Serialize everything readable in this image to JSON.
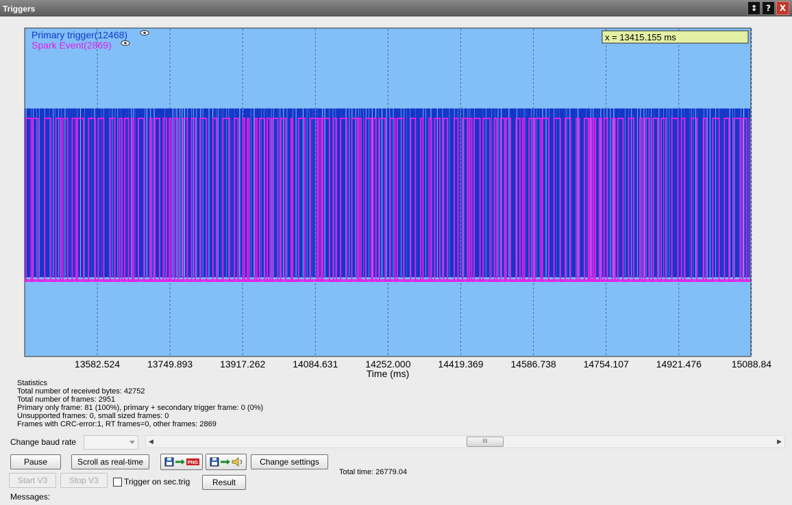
{
  "window": {
    "title": "Triggers",
    "buttons": [
      "↕",
      "?",
      "X"
    ]
  },
  "chart_data": {
    "type": "line",
    "series": [
      {
        "name": "Primary trigger(12468)",
        "color": "#1437c8"
      },
      {
        "name": "Spark Event(2869)",
        "color": "#e020e6"
      }
    ],
    "cursor_readout": "x = 13415.155 ms",
    "xlabel": "Time (ms)",
    "x_ticks": [
      "13582.524",
      "13749.893",
      "13917.262",
      "14084.631",
      "14252.000",
      "14419.369",
      "14586.738",
      "14754.107",
      "14921.476",
      "15088.84"
    ],
    "xlim": [
      13415.155,
      15088.845
    ],
    "grid": "vertical dashed",
    "legend": "top-left",
    "background": "#82bff8"
  },
  "statistics": {
    "heading": "Statistics",
    "lines": [
      "Total number of received bytes: 42752",
      "Total number of frames: 2951",
      "Primary only frame: 81 (100%), primary + secondary trigger frame: 0 (0%)",
      "Unsupported frames: 0, small sized frames: 0",
      "Frames with CRC-error:1, RT frames=0, other frames: 2869"
    ]
  },
  "controls": {
    "baud_label": "Change baud rate",
    "baud_value": "",
    "scroll_thumb": "III",
    "pause": "Pause",
    "scroll_realtime": "Scroll as real-time",
    "png_badge": "PNG",
    "change_settings": "Change settings",
    "total_time": "Total time: 26779.04",
    "start_v3": "Start V3",
    "stop_v3": "Stop V3",
    "trigger_on_sec": "Trigger on sec.trig",
    "result": "Result",
    "messages": "Messages:"
  }
}
